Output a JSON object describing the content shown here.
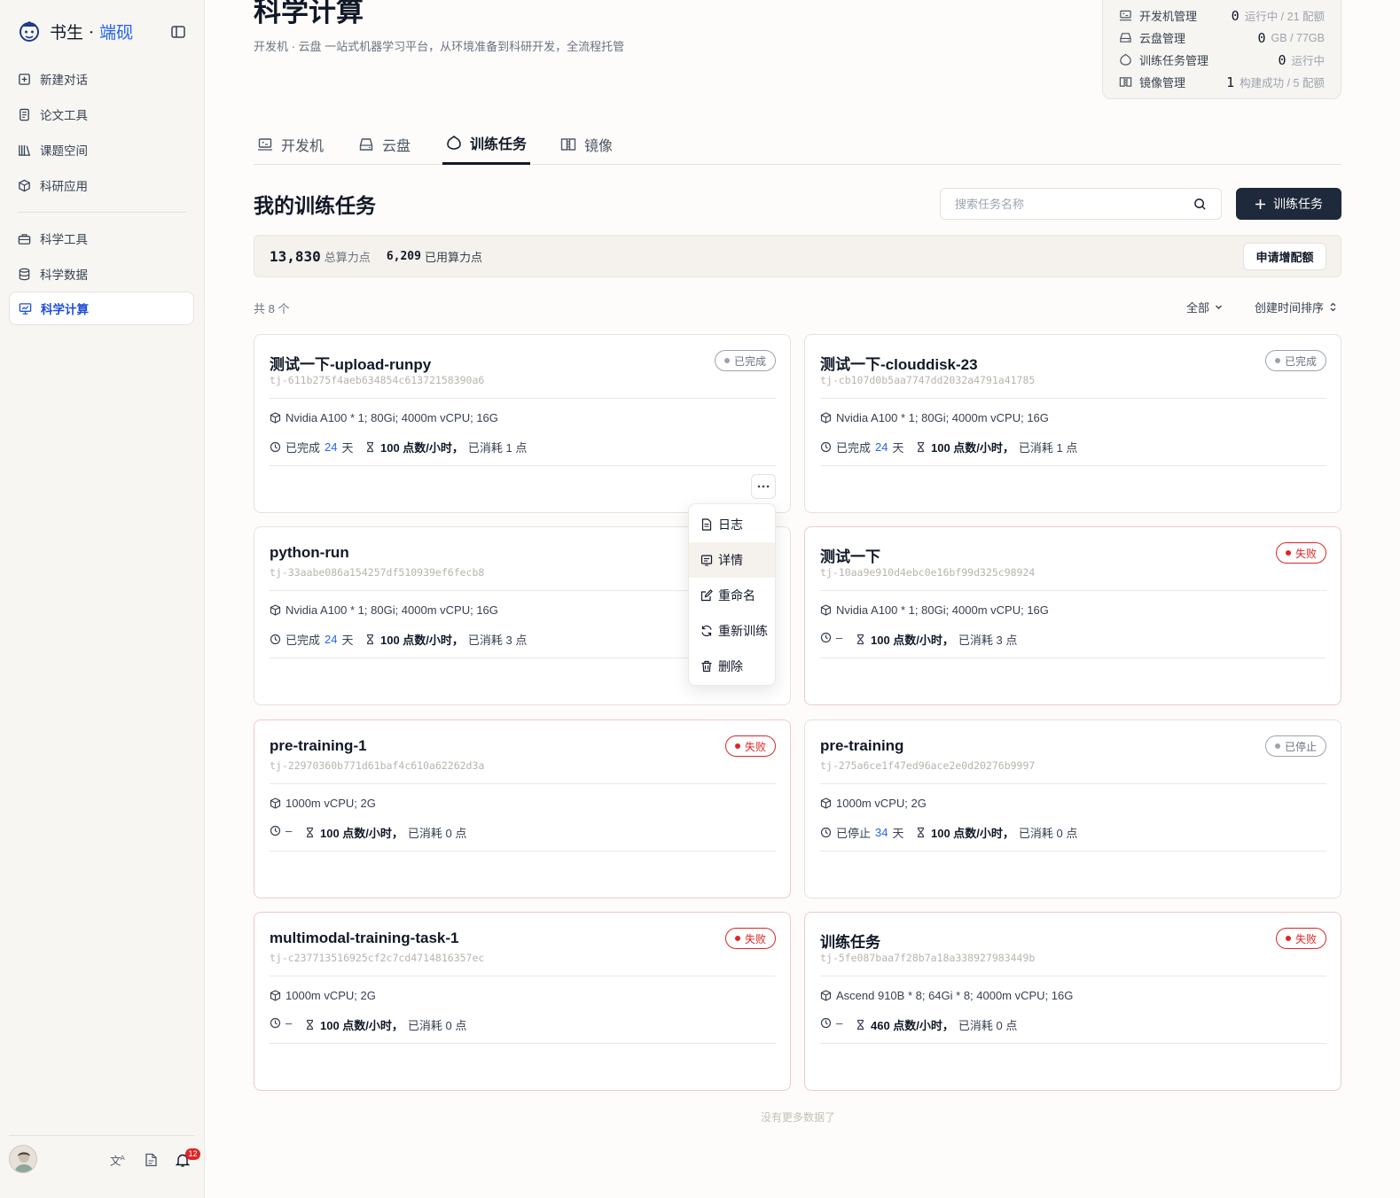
{
  "brand": {
    "name_a": "书生",
    "sep": " · ",
    "name_b": "端砚"
  },
  "sidebar": {
    "items": [
      {
        "label": "新建对话",
        "icon": "plus-square-icon"
      },
      {
        "label": "论文工具",
        "icon": "document-icon"
      },
      {
        "label": "课题空间",
        "icon": "books-icon"
      },
      {
        "label": "科研应用",
        "icon": "cube-icon"
      },
      {
        "label": "科学工具",
        "icon": "toolbox-icon"
      },
      {
        "label": "科学数据",
        "icon": "database-icon"
      },
      {
        "label": "科学计算",
        "icon": "monitor-icon",
        "active": true
      }
    ],
    "notification_count": "12"
  },
  "header": {
    "title": "科学计算",
    "subtitle": "开发机 · 云盘 一站式机器学习平台，从环境准备到科研开发，全流程托管"
  },
  "stats": [
    {
      "label": "开发机管理",
      "value": "0",
      "unit": "运行中 / 21 配额",
      "icon": "devbox-icon"
    },
    {
      "label": "云盘管理",
      "value": "0",
      "unit": "GB / 77GB",
      "icon": "disk-icon"
    },
    {
      "label": "训练任务管理",
      "value": "0",
      "unit": "运行中",
      "icon": "training-icon"
    },
    {
      "label": "镜像管理",
      "value": "1",
      "unit": "构建成功 / 5 配额",
      "icon": "mirror-icon"
    }
  ],
  "tabs": [
    {
      "label": "开发机"
    },
    {
      "label": "云盘"
    },
    {
      "label": "训练任务",
      "active": true
    },
    {
      "label": "镜像"
    }
  ],
  "section": {
    "title": "我的训练任务",
    "search_placeholder": "搜索任务名称",
    "new_button": "训练任务"
  },
  "quota": {
    "total_value": "13,830",
    "total_label": "总算力点",
    "used_value": "6,209",
    "used_label": "已用算力点",
    "apply_button": "申请增配额"
  },
  "list": {
    "count_text": "共 8 个",
    "filter_label": "全部",
    "sort_label": "创建时间排序",
    "footer": "没有更多数据了"
  },
  "tasks": [
    {
      "name": "测试一下-upload-runpy",
      "id": "tj-611b275f4aeb634854c61372158390a6",
      "status": "已完成",
      "status_type": "done",
      "spec": "Nvidia A100 * 1;  80Gi;  4000m vCPU;  16G",
      "duration_prefix": "已完成",
      "duration_num": "24",
      "duration_unit": "天",
      "rate": "100 点数/小时，",
      "consumed": "已消耗 1 点"
    },
    {
      "name": "测试一下-clouddisk-23",
      "id": "tj-cb107d0b5aa7747dd2032a4791a41785",
      "status": "已完成",
      "status_type": "done",
      "spec": "Nvidia A100 * 1;  80Gi;  4000m vCPU;  16G",
      "duration_prefix": "已完成",
      "duration_num": "24",
      "duration_unit": "天",
      "rate": "100 点数/小时，",
      "consumed": "已消耗 1 点"
    },
    {
      "name": "python-run",
      "id": "tj-33aabe086a154257df510939ef6fecb8",
      "status": "",
      "status_type": "none",
      "spec": "Nvidia A100 * 1;  80Gi;  4000m vCPU;  16G",
      "duration_prefix": "已完成",
      "duration_num": "24",
      "duration_unit": "天",
      "rate": "100 点数/小时，",
      "consumed": "已消耗 3 点"
    },
    {
      "name": "测试一下",
      "id": "tj-10aa9e910d4ebc0e16bf99d325c98924",
      "status": "失败",
      "status_type": "fail",
      "spec": "Nvidia A100 * 1;  80Gi;  4000m vCPU;  16G",
      "duration_prefix": "–",
      "duration_num": "",
      "duration_unit": "",
      "rate": "100 点数/小时，",
      "consumed": "已消耗 3 点"
    },
    {
      "name": "pre-training-1",
      "id": "tj-22970360b771d61baf4c610a62262d3a",
      "status": "失败",
      "status_type": "fail",
      "spec": "1000m vCPU;  2G",
      "duration_prefix": "–",
      "duration_num": "",
      "duration_unit": "",
      "rate": "100 点数/小时，",
      "consumed": "已消耗 0 点"
    },
    {
      "name": "pre-training",
      "id": "tj-275a6ce1f47ed96ace2e0d20276b9997",
      "status": "已停止",
      "status_type": "stopped",
      "spec": "1000m vCPU;  2G",
      "duration_prefix": "已停止",
      "duration_num": "34",
      "duration_unit": "天",
      "rate": "100 点数/小时，",
      "consumed": "已消耗 0 点"
    },
    {
      "name": "multimodal-training-task-1",
      "id": "tj-c237713516925cf2c7cd4714816357ec",
      "status": "失败",
      "status_type": "fail",
      "spec": "1000m vCPU;  2G",
      "duration_prefix": "–",
      "duration_num": "",
      "duration_unit": "",
      "rate": "100 点数/小时，",
      "consumed": "已消耗 0 点"
    },
    {
      "name": "训练任务",
      "id": "tj-5fe087baa7f28b7a18a338927983449b",
      "status": "失败",
      "status_type": "fail",
      "spec": "Ascend 910B * 8;  64Gi * 8;  4000m vCPU;  16G",
      "duration_prefix": "–",
      "duration_num": "",
      "duration_unit": "",
      "rate": "460 点数/小时，",
      "consumed": "已消耗 0 点"
    }
  ],
  "menu": {
    "items": [
      {
        "label": "日志",
        "icon": "log-icon"
      },
      {
        "label": "详情",
        "icon": "detail-icon"
      },
      {
        "label": "重命名",
        "icon": "rename-icon"
      },
      {
        "label": "重新训练",
        "icon": "retrain-icon"
      },
      {
        "label": "删除",
        "icon": "trash-icon"
      }
    ]
  }
}
